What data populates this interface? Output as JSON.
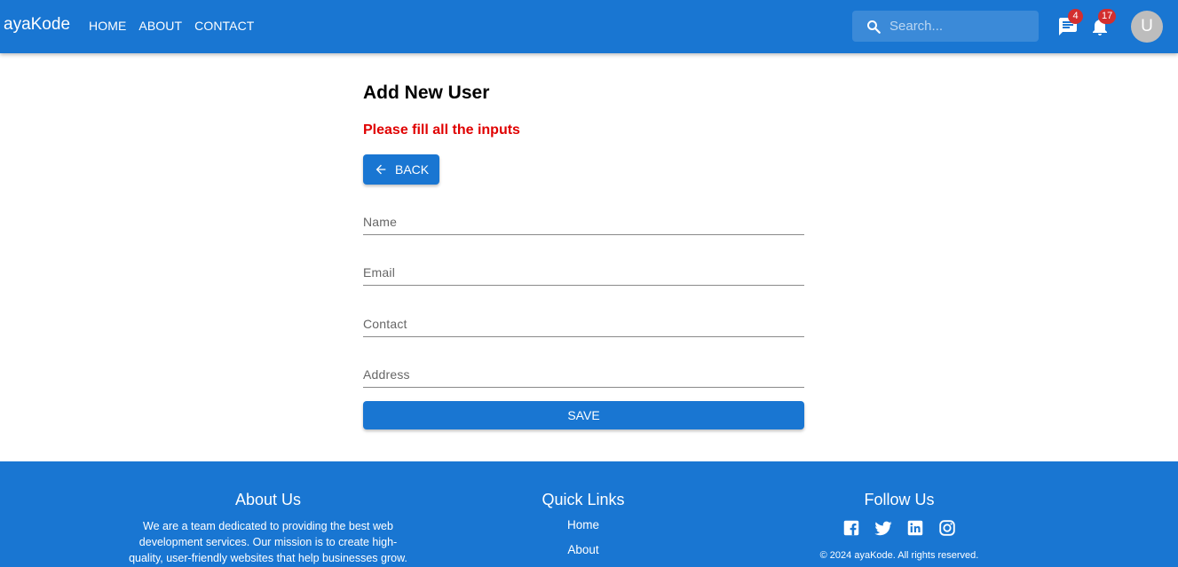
{
  "header": {
    "brand": "ayaKode",
    "nav": [
      "HOME",
      "ABOUT",
      "CONTACT"
    ],
    "search_placeholder": "Search...",
    "messages_badge": "4",
    "notifications_badge": "17",
    "avatar_initial": "U"
  },
  "main": {
    "title": "Add New User",
    "error": "Please fill all the inputs",
    "back_label": "BACK",
    "fields": {
      "name": "Name",
      "email": "Email",
      "contact": "Contact",
      "address": "Address"
    },
    "save_label": "SAVE"
  },
  "footer": {
    "about_title": "About Us",
    "about_text": "We are a team dedicated to providing the best web development services. Our mission is to create high-quality, user-friendly websites that help businesses grow.",
    "links_title": "Quick Links",
    "links": [
      "Home",
      "About"
    ],
    "follow_title": "Follow Us",
    "social_icons": [
      "facebook-icon",
      "twitter-icon",
      "linkedin-icon",
      "instagram-icon"
    ],
    "copyright": "© 2024 ayaKode. All rights reserved."
  },
  "colors": {
    "primary": "#1976d2",
    "error": "#e00000",
    "badge": "#d32f2f"
  }
}
